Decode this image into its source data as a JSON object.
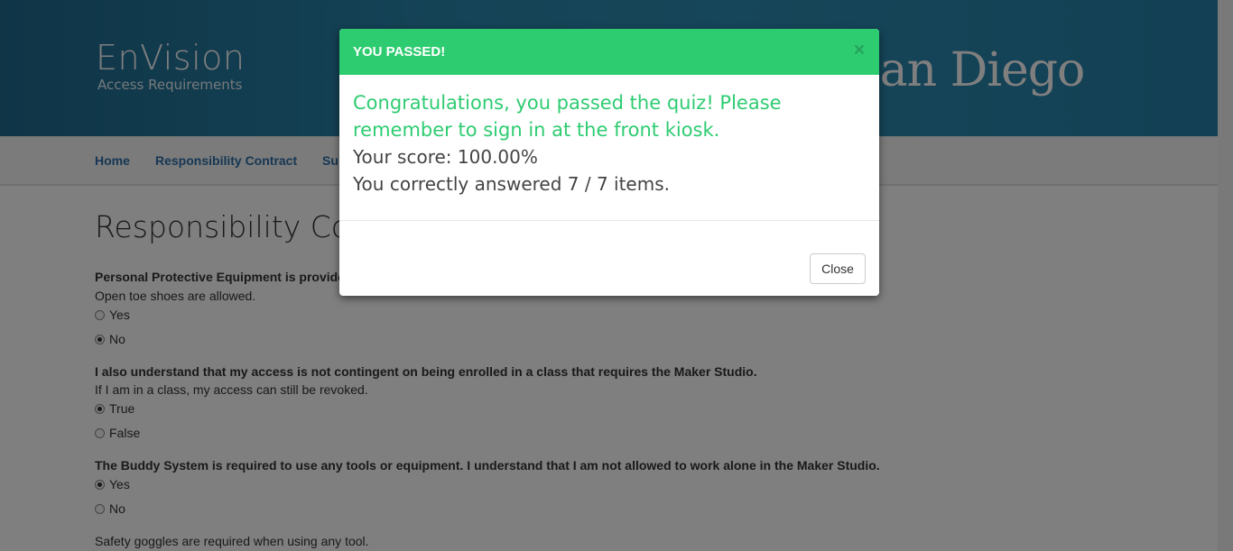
{
  "header": {
    "brand_title": "EnVision",
    "brand_subtitle": "Access Requirements",
    "logo_text": "San Diego"
  },
  "nav": {
    "items": [
      "Home",
      "Responsibility Contract",
      "Su"
    ]
  },
  "main": {
    "title": "Responsibility Contr",
    "q1": {
      "prompt": "Personal Protective Equipment is provide",
      "note": "Open toe shoes are allowed.",
      "options": [
        "Yes",
        "No"
      ],
      "selected": "No"
    },
    "q2": {
      "prompt": "I also understand that my access is not contingent on being enrolled in a class that requires the Maker Studio.",
      "note": "If I am in a class, my access can still be revoked.",
      "options": [
        "True",
        "False"
      ],
      "selected": "True"
    },
    "q3": {
      "prompt": "The Buddy System is required to use any tools or equipment. I understand that I am not allowed to work alone in the Maker Studio.",
      "options": [
        "Yes",
        "No"
      ],
      "selected": "Yes"
    },
    "q4": {
      "prompt": "Safety goggles are required when using any tool."
    }
  },
  "modal": {
    "title": "YOU PASSED!",
    "close_x": "×",
    "congrats": "Congratulations, you passed the quiz! Please remember to sign in at the front kiosk.",
    "score": "Your score: 100.00%",
    "answered": "You correctly answered 7 / 7 items.",
    "close_label": "Close"
  },
  "colors": {
    "header_blue": "#2a86ad",
    "success_green": "#2ecc71",
    "nav_link": "#2c6fa8"
  }
}
